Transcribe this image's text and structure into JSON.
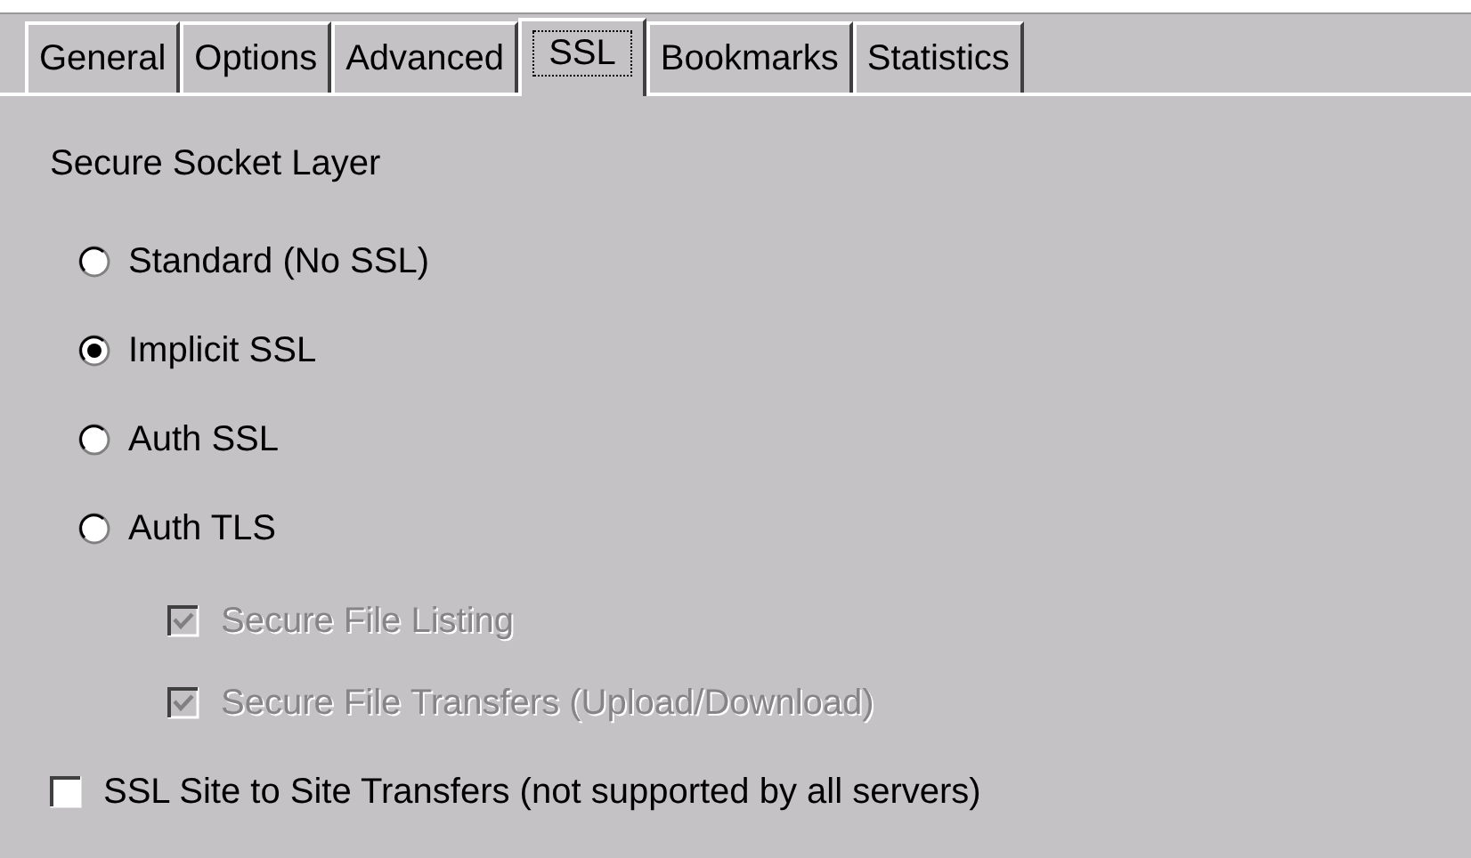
{
  "tabs": [
    {
      "label": "General",
      "selected": false
    },
    {
      "label": "Options",
      "selected": false
    },
    {
      "label": "Advanced",
      "selected": false
    },
    {
      "label": "SSL",
      "selected": true
    },
    {
      "label": "Bookmarks",
      "selected": false
    },
    {
      "label": "Statistics",
      "selected": false
    }
  ],
  "section_title": "Secure Socket Layer",
  "radios": [
    {
      "label": "Standard (No SSL)",
      "selected": false
    },
    {
      "label": "Implicit SSL",
      "selected": true
    },
    {
      "label": "Auth SSL",
      "selected": false
    },
    {
      "label": "Auth TLS",
      "selected": false,
      "children": [
        {
          "label": "Secure File Listing",
          "checked": true,
          "disabled": true
        },
        {
          "label": "Secure File Transfers (Upload/Download)",
          "checked": true,
          "disabled": true
        }
      ]
    }
  ],
  "checkboxes": [
    {
      "label": "SSL Site to Site Transfers (not supported by all servers)",
      "checked": false,
      "disabled": false
    }
  ]
}
